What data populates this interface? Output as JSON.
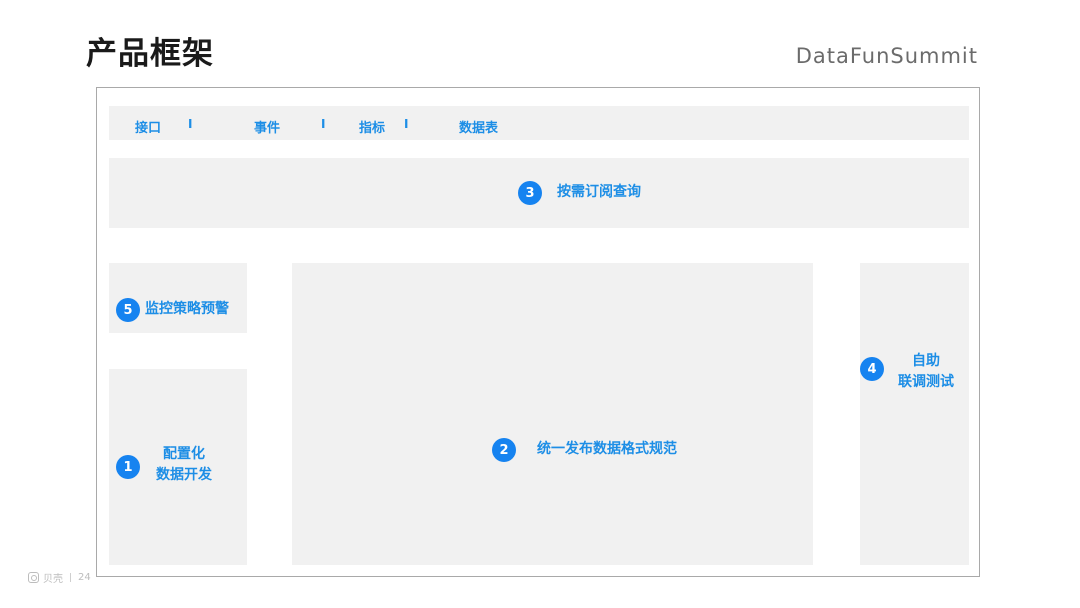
{
  "header": {
    "title": "产品框架",
    "brand": "DataFunSummit"
  },
  "tabs": [
    {
      "label": "接口"
    },
    {
      "label": "事件"
    },
    {
      "label": "指标"
    },
    {
      "label": "数据表"
    }
  ],
  "separator": "I",
  "modules": {
    "subscribe": {
      "number": "3",
      "label": "按需订阅查询"
    },
    "monitor": {
      "number": "5",
      "label": "监控策略预警"
    },
    "config": {
      "number": "1",
      "line1": "配置化",
      "line2": "数据开发"
    },
    "publish": {
      "number": "2",
      "label": "统一发布数据格式规范"
    },
    "testing": {
      "number": "4",
      "line1": "自助",
      "line2": "联调测试"
    }
  },
  "footer": {
    "logo_text": "贝壳",
    "page_number": "24"
  }
}
